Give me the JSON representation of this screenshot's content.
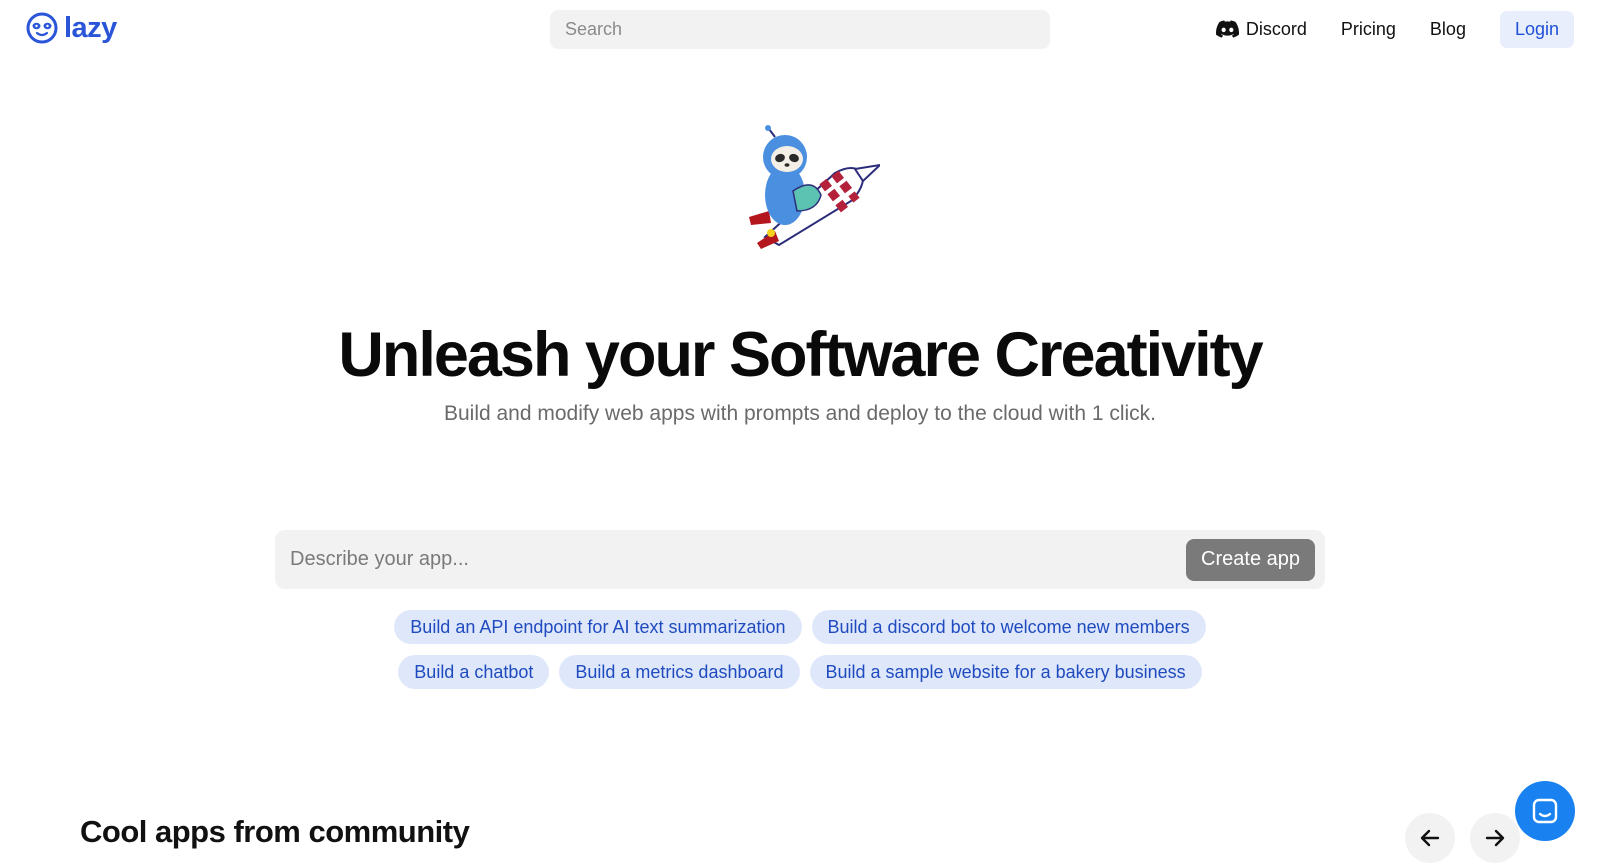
{
  "header": {
    "logo_text": "lazy",
    "search_placeholder": "Search",
    "nav": {
      "discord_label": "Discord",
      "pricing_label": "Pricing",
      "blog_label": "Blog",
      "login_label": "Login"
    }
  },
  "hero": {
    "headline": "Unleash your Software Creativity",
    "subhead": "Build and modify web apps with prompts and deploy to the cloud with 1 click.",
    "prompt_placeholder": "Describe your app...",
    "create_button_label": "Create app",
    "suggestions": [
      "Build an API endpoint for AI text summarization",
      "Build a discord bot to welcome new members",
      "Build a chatbot",
      "Build a metrics dashboard",
      "Build a sample website for a bakery business"
    ]
  },
  "community": {
    "title": "Cool apps from community"
  },
  "colors": {
    "brand": "#2a55d9",
    "chip_bg": "#dfe8fb",
    "chip_text": "#1f4bbf",
    "create_button_bg": "#7a7a7a",
    "chat_launcher": "#1a82f0"
  },
  "icons": {
    "logo": "sloth-face-icon",
    "discord": "discord-icon",
    "prev": "arrow-left-icon",
    "next": "arrow-right-icon",
    "chat": "chat-launcher-icon",
    "mascot": "sloth-rocket-illustration"
  }
}
